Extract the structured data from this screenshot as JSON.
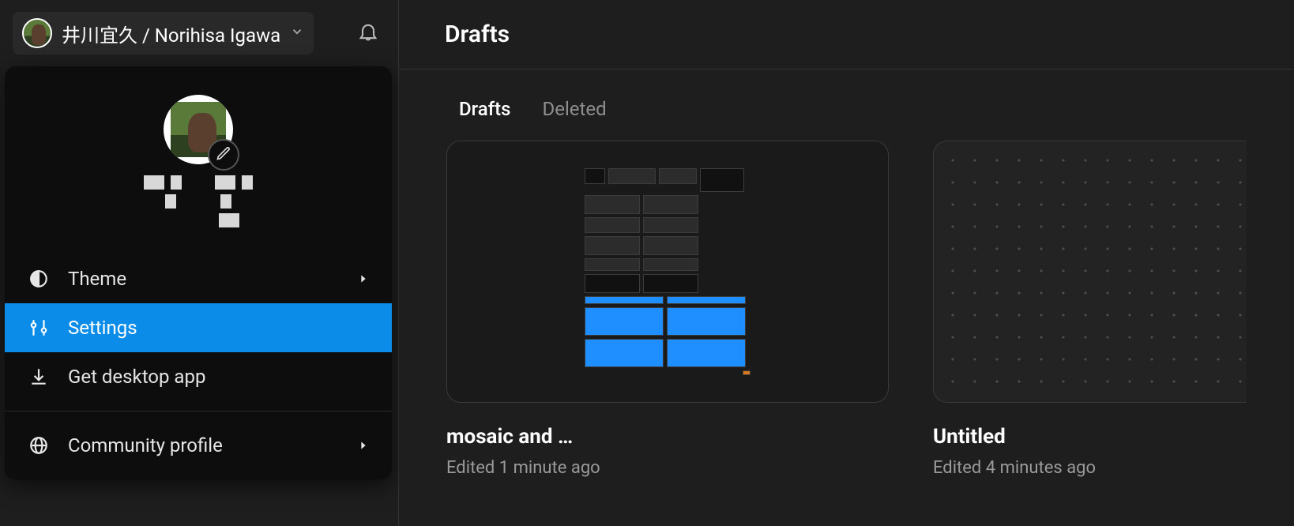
{
  "header": {
    "account_label": "井川宜久 / Norihisa Igawa"
  },
  "dropdown": {
    "menu": {
      "theme": "Theme",
      "settings": "Settings",
      "get_desktop": "Get desktop app",
      "community_profile": "Community profile"
    }
  },
  "main": {
    "title": "Drafts",
    "tabs": {
      "drafts": "Drafts",
      "deleted": "Deleted"
    },
    "cards": [
      {
        "title": "mosaic and …",
        "subtitle": "Edited 1 minute ago"
      },
      {
        "title": "Untitled",
        "subtitle": "Edited 4 minutes ago"
      }
    ]
  }
}
